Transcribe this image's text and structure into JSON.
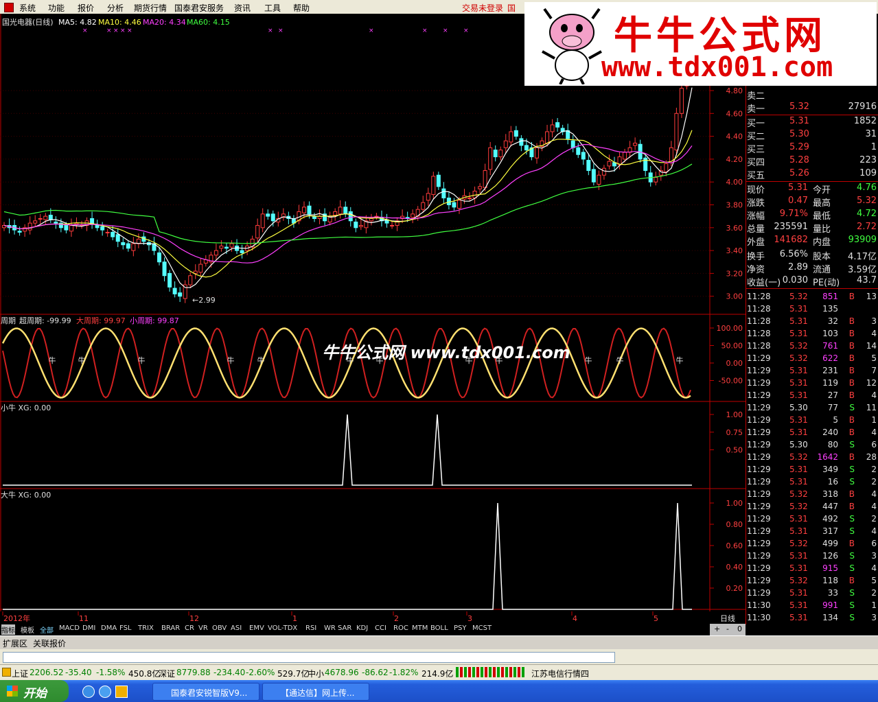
{
  "menu": [
    "系统",
    "功能",
    "报价",
    "分析",
    "期货行情",
    "国泰君安服务",
    "资讯",
    "工具",
    "帮助"
  ],
  "menu_status": "交易未登录",
  "menu_guo": "国",
  "logo": {
    "title": "牛牛公式网",
    "url": "www.tdx001.com"
  },
  "watermark": "牛牛公式网 www.tdx001.com",
  "price_panel": {
    "stock": "国光电器(日线)",
    "ma": [
      {
        "label": "MA5: 4.82",
        "color": "#ffffff"
      },
      {
        "label": "MA10: 4.46",
        "color": "#ffff40"
      },
      {
        "label": "MA20: 4.34",
        "color": "#ff40ff"
      },
      {
        "label": "MA60: 4.15",
        "color": "#40ff40"
      }
    ],
    "axis": [
      "4.80",
      "4.60",
      "4.40",
      "4.20",
      "4.00",
      "3.80",
      "3.60",
      "3.40",
      "3.20",
      "3.00"
    ],
    "low_label": "←2.99"
  },
  "cycle_panel": {
    "title": "周期",
    "items": [
      {
        "label": "超周期: -99.99",
        "color": "#e0e0e0"
      },
      {
        "label": "大周期: 99.97",
        "color": "#ff4040"
      },
      {
        "label": "小周期: 99.87",
        "color": "#ff40ff"
      }
    ],
    "axis": [
      "100.00",
      "50.00",
      "0.00",
      "-50.00"
    ],
    "marker": "牛"
  },
  "small_panel": {
    "title": "小牛  XG: 0.00",
    "axis": [
      "1.00",
      "0.75",
      "0.50"
    ]
  },
  "big_panel": {
    "title": "大牛  XG: 0.00",
    "axis": [
      "1.00",
      "0.80",
      "0.60",
      "0.40",
      "0.20"
    ]
  },
  "dates": [
    "2012年",
    "11",
    "12",
    "1",
    "2",
    "3",
    "4",
    "5"
  ],
  "period": "日线",
  "quotes": {
    "sell": [
      {
        "label": "卖二",
        "price": "",
        "vol": ""
      },
      {
        "label": "卖一",
        "price": "5.32",
        "vol": "27916"
      }
    ],
    "buy": [
      {
        "label": "买一",
        "price": "5.31",
        "vol": "1852"
      },
      {
        "label": "买二",
        "price": "5.30",
        "vol": "31"
      },
      {
        "label": "买三",
        "price": "5.29",
        "vol": "1"
      },
      {
        "label": "买四",
        "price": "5.28",
        "vol": "223"
      },
      {
        "label": "买五",
        "price": "5.26",
        "vol": "109"
      }
    ],
    "stats": [
      {
        "l1": "现价",
        "v1": "5.31",
        "c1": "#ff4040",
        "l2": "今开",
        "v2": "4.76",
        "c2": "#40ff40"
      },
      {
        "l1": "涨跌",
        "v1": "0.47",
        "c1": "#ff4040",
        "l2": "最高",
        "v2": "5.32",
        "c2": "#ff4040"
      },
      {
        "l1": "涨幅",
        "v1": "9.71%",
        "c1": "#ff4040",
        "l2": "最低",
        "v2": "4.72",
        "c2": "#40ff40"
      },
      {
        "l1": "总量",
        "v1": "235591",
        "c1": "#e0e0e0",
        "l2": "量比",
        "v2": "2.72",
        "c2": "#ff4040"
      },
      {
        "l1": "外盘",
        "v1": "141682",
        "c1": "#ff4040",
        "l2": "内盘",
        "v2": "93909",
        "c2": "#40ff40"
      },
      {
        "l1": "换手",
        "v1": "6.56%",
        "c1": "#e0e0e0",
        "l2": "股本",
        "v2": "4.17亿",
        "c2": "#e0e0e0"
      },
      {
        "l1": "净资",
        "v1": "2.89",
        "c1": "#e0e0e0",
        "l2": "流通",
        "v2": "3.59亿",
        "c2": "#e0e0e0"
      },
      {
        "l1": "收益(一)",
        "v1": "0.030",
        "c1": "#e0e0e0",
        "l2": "PE(动)",
        "v2": "43.7",
        "c2": "#e0e0e0"
      }
    ],
    "trades": [
      [
        "11:28",
        "5.32",
        "851",
        "B",
        "13"
      ],
      [
        "11:28",
        "5.31",
        "135",
        "",
        ""
      ],
      [
        "11:28",
        "5.31",
        "32",
        "B",
        "3"
      ],
      [
        "11:28",
        "5.31",
        "103",
        "B",
        "4"
      ],
      [
        "11:28",
        "5.32",
        "761",
        "B",
        "14"
      ],
      [
        "11:29",
        "5.32",
        "622",
        "B",
        "5"
      ],
      [
        "11:29",
        "5.31",
        "231",
        "B",
        "7"
      ],
      [
        "11:29",
        "5.31",
        "119",
        "B",
        "12"
      ],
      [
        "11:29",
        "5.31",
        "27",
        "B",
        "4"
      ],
      [
        "11:29",
        "5.30",
        "77",
        "S",
        "11"
      ],
      [
        "11:29",
        "5.31",
        "5",
        "B",
        "1"
      ],
      [
        "11:29",
        "5.31",
        "240",
        "B",
        "4"
      ],
      [
        "11:29",
        "5.30",
        "80",
        "S",
        "6"
      ],
      [
        "11:29",
        "5.32",
        "1642",
        "B",
        "28"
      ],
      [
        "11:29",
        "5.31",
        "349",
        "S",
        "2"
      ],
      [
        "11:29",
        "5.31",
        "16",
        "S",
        "2"
      ],
      [
        "11:29",
        "5.32",
        "318",
        "B",
        "4"
      ],
      [
        "11:29",
        "5.32",
        "447",
        "B",
        "4"
      ],
      [
        "11:29",
        "5.31",
        "492",
        "S",
        "2"
      ],
      [
        "11:29",
        "5.31",
        "317",
        "S",
        "4"
      ],
      [
        "11:29",
        "5.32",
        "499",
        "B",
        "6"
      ],
      [
        "11:29",
        "5.31",
        "126",
        "S",
        "3"
      ],
      [
        "11:29",
        "5.31",
        "915",
        "S",
        "4"
      ],
      [
        "11:29",
        "5.32",
        "118",
        "B",
        "5"
      ],
      [
        "11:29",
        "5.31",
        "33",
        "S",
        "2"
      ],
      [
        "11:30",
        "5.31",
        "991",
        "S",
        "1"
      ],
      [
        "11:30",
        "5.31",
        "134",
        "S",
        "3"
      ]
    ]
  },
  "tabs": [
    "指标",
    "模板",
    "全部",
    "MACD",
    "DMI",
    "DMA",
    "FSL",
    "TRIX",
    "BRAR",
    "CR",
    "VR",
    "OBV",
    "ASI",
    "EMV",
    "VOL-TDX",
    "RSI",
    "WR",
    "SAR",
    "KDJ",
    "CCI",
    "ROC",
    "MTM",
    "BOLL",
    "PSY",
    "MCST"
  ],
  "zoom": [
    "+",
    "-",
    "0"
  ],
  "ext": [
    "扩展区",
    "关联报价"
  ],
  "status": {
    "sh_label": "上证",
    "sh_val": "2206.52",
    "sh_chg": "-35.40",
    "sh_pct": "-1.58%",
    "sh_amt": "450.8亿",
    "sz_label": "深证",
    "sz_val": "8779.88",
    "sz_chg": "-234.40",
    "sz_pct": "-2.60%",
    "sz_amt": "529.7亿",
    "zx_label": "中小",
    "zx_val": "4678.96",
    "zx_chg": "-86.62",
    "zx_pct": "-1.82%",
    "zx_amt": "214.9亿",
    "info": "江苏电信行情四"
  },
  "taskbar": {
    "start": "开始",
    "items": [
      "国泰君安锐智版V9...",
      "【通达信】网上传..."
    ]
  }
}
